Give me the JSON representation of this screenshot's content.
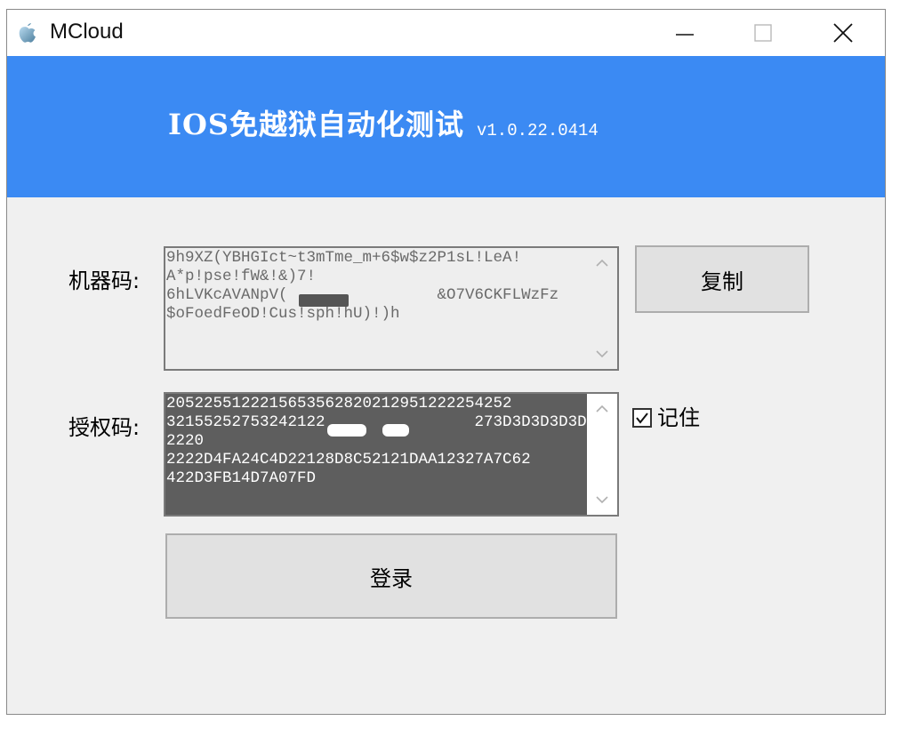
{
  "window": {
    "title": "MCloud",
    "icon": "apple-icon",
    "controls": [
      "minimize-icon",
      "maximize-icon",
      "close-icon"
    ]
  },
  "header": {
    "title": "IOS免越狱自动化测试",
    "version": "v1.0.22.0414",
    "background": "#3b8af3"
  },
  "machine_code": {
    "label": "机器码:",
    "lines": [
      "9h9XZ(YBHGIct~t3mTme_m+6$w$z2P1sL!LeA!",
      "A*p!pse!fW&!&)7!",
      "6hLVKcAVANpV(                &O7V6CKFLWzFz",
      "$oFoedFeOD!Cus!sph!hU)!)h"
    ]
  },
  "copy_button": {
    "label": "复制"
  },
  "auth_code": {
    "label": "授权码:",
    "lines": [
      "2052255122215653562820212951222254252",
      "32155252753242122                273D3D3D3D3D2220",
      "2222D4FA24C4D22128D8C52121DAA12327A7C62",
      "422D3FB14D7A07FD"
    ]
  },
  "remember": {
    "label": "记住",
    "checked": true
  },
  "login_button": {
    "label": "登录"
  }
}
